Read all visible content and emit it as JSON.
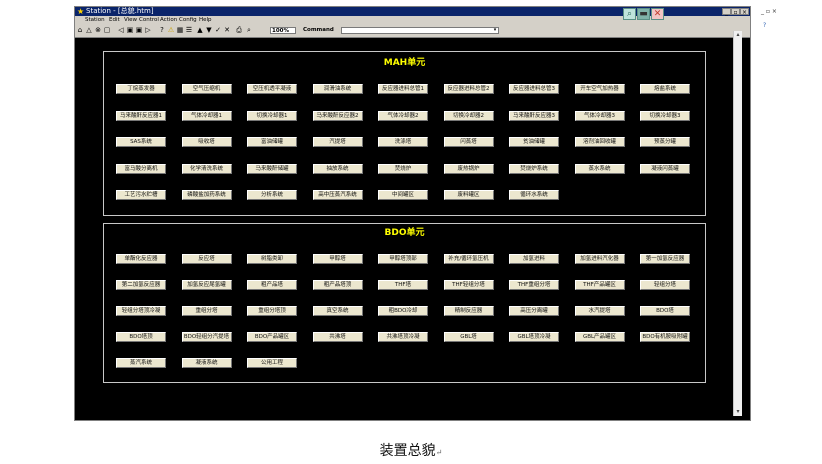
{
  "window": {
    "title": "Station - [总貌.htm]",
    "menu": [
      "Station",
      "Edit",
      "View",
      "Control",
      "Action",
      "Config",
      "Help"
    ]
  },
  "toolbar": {
    "zoom": "100%",
    "command_label": "Command"
  },
  "mah": {
    "title": "MAH单元",
    "rows": [
      [
        "丁烷蒸发器",
        "空气压缩机",
        "空压机透平凝液",
        "润滑油系统",
        "反应器进料总管1",
        "反应器进料总管2",
        "反应器进料总管3",
        "开车空气加热器",
        "熔盐系统"
      ],
      [
        "马来酸酐反应器1",
        "气体冷却器1",
        "切换冷却器1",
        "马来酸酐反应器2",
        "气体冷却器2",
        "切换冷却器2",
        "马来酸酐反应器3",
        "气体冷却器3",
        "切换冷却器3"
      ],
      [
        "SAS系统",
        "吸收塔",
        "富油储罐",
        "汽提塔",
        "洗涤塔",
        "闪蒸塔",
        "贫油储罐",
        "溶剂油回收罐",
        "预蒸分罐"
      ],
      [
        "富马酸分离机",
        "化学清洗系统",
        "马来酸酐储罐",
        "抽放系统",
        "焚烧炉",
        "废热锅炉",
        "焚烧炉系统",
        "蒸水系统",
        "凝液闪蒸罐"
      ],
      [
        "工艺污水贮槽",
        "磷酸盐加药系统",
        "分析系统",
        "高中压蒸汽系统",
        "中间罐区",
        "废料罐区",
        "循环水系统"
      ]
    ]
  },
  "bdo": {
    "title": "BDO单元",
    "rows": [
      [
        "单酯化反应器",
        "反应塔",
        "树脂类卸",
        "甲醇塔",
        "甲醇塔顶部",
        "补充/循环氢压机",
        "加氢进料",
        "加氢进料汽化器",
        "第一加氢反应器"
      ],
      [
        "第二加氢反应器",
        "加氢反应尾氢罐",
        "粗产品塔",
        "粗产品塔顶",
        "THF塔",
        "THF轻组分塔",
        "THF重组分塔",
        "THF产品罐区",
        "轻组分塔"
      ],
      [
        "轻组分塔顶冷凝",
        "重组分塔",
        "重组分塔顶",
        "真空系统",
        "粗BDO冷却",
        "精制反应器",
        "高压分离罐",
        "水汽提塔",
        "BDO塔"
      ],
      [
        "BDO塔顶",
        "BDO轻组分汽提塔",
        "BDO产品罐区",
        "共沸塔",
        "共沸塔顶冷凝",
        "GBL塔",
        "GBL塔顶冷凝",
        "GBL产品罐区",
        "BDO有机胺吸附罐"
      ],
      [
        "蒸汽系统",
        "凝液系统",
        "公用工程"
      ]
    ]
  },
  "caption": "装置总貌",
  "caption_mark": "↵"
}
